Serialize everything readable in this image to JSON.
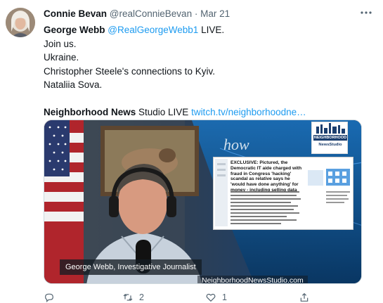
{
  "tweet": {
    "author_name": "Connie Bevan",
    "author_handle": "@realConnieBevan",
    "separator": "·",
    "date": "Mar 21",
    "lines": {
      "l1_bold": "George Webb",
      "l1_link": "@RealGeorgeWebb1",
      "l1_rest": " LIVE.",
      "l2": "Join us.",
      "l3": "Ukraine.",
      "l4": "Christopher Steele's connections to Kyiv.",
      "l5": "Nataliia Sova.",
      "l6_bold": "Neighborhood News",
      "l6_rest": " Studio LIVE ",
      "l6_link": "twitch.tv/neighborhoodne…"
    }
  },
  "media": {
    "lower_third": "George Webb, Investigative Journalist",
    "site": "NeighborhoodNewsStudio.com",
    "watermark": "how",
    "logo_line1": "NEIGHBORHOOD",
    "logo_line2": "NewsStudio",
    "article_headline": "EXCLUSIVE: Pictured, the Democratic IT aide charged with fraud in Congress 'hacking' scandal as relative says he 'would have done anything' for money - including selling data"
  },
  "actions": {
    "retweet_count": "2",
    "like_count": "1"
  }
}
